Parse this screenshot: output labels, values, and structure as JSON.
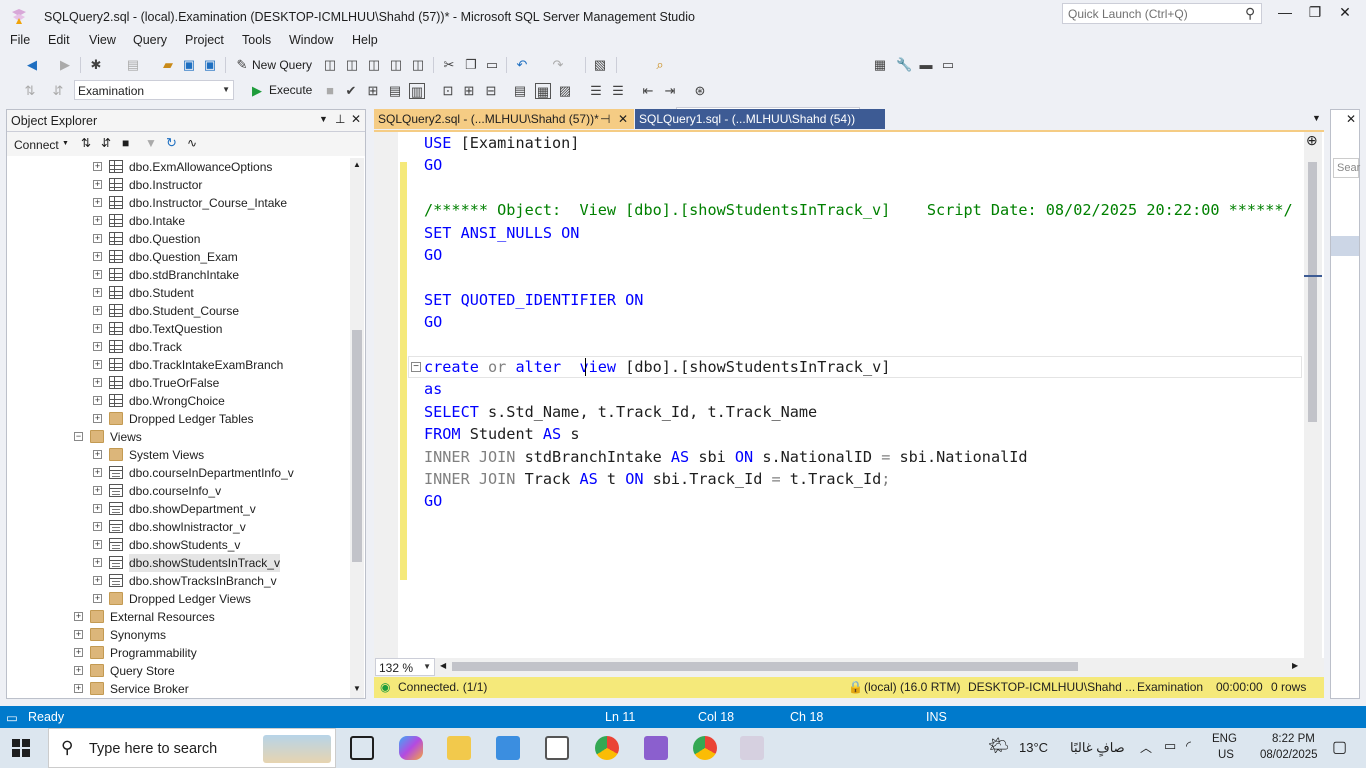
{
  "window": {
    "title": "SQLQuery2.sql - (local).Examination (DESKTOP-ICMLHUU\\Shahd (57))* - Microsoft SQL Server Management Studio",
    "quick_launch_placeholder": "Quick Launch (Ctrl+Q)"
  },
  "menu": [
    "File",
    "Edit",
    "View",
    "Query",
    "Project",
    "Tools",
    "Window",
    "Help"
  ],
  "toolbar": {
    "new_query": "New Query",
    "database": "Examination",
    "execute": "Execute"
  },
  "object_explorer": {
    "title": "Object Explorer",
    "connect": "Connect",
    "nodes": [
      {
        "label": "dbo.ExmAllowanceOptions",
        "type": "table",
        "level": 4
      },
      {
        "label": "dbo.Instructor",
        "type": "table",
        "level": 4
      },
      {
        "label": "dbo.Instructor_Course_Intake",
        "type": "table",
        "level": 4
      },
      {
        "label": "dbo.Intake",
        "type": "table",
        "level": 4
      },
      {
        "label": "dbo.Question",
        "type": "table",
        "level": 4
      },
      {
        "label": "dbo.Question_Exam",
        "type": "table",
        "level": 4
      },
      {
        "label": "dbo.stdBranchIntake",
        "type": "table",
        "level": 4
      },
      {
        "label": "dbo.Student",
        "type": "table",
        "level": 4
      },
      {
        "label": "dbo.Student_Course",
        "type": "table",
        "level": 4
      },
      {
        "label": "dbo.TextQuestion",
        "type": "table",
        "level": 4
      },
      {
        "label": "dbo.Track",
        "type": "table",
        "level": 4
      },
      {
        "label": "dbo.TrackIntakeExamBranch",
        "type": "table",
        "level": 4
      },
      {
        "label": "dbo.TrueOrFalse",
        "type": "table",
        "level": 4
      },
      {
        "label": "dbo.WrongChoice",
        "type": "table",
        "level": 4
      },
      {
        "label": "Dropped Ledger Tables",
        "type": "folder",
        "level": 4
      },
      {
        "label": "Views",
        "type": "folder",
        "level": 3,
        "expanded": true
      },
      {
        "label": "System Views",
        "type": "folder",
        "level": 4
      },
      {
        "label": "dbo.courseInDepartmentInfo_v",
        "type": "view",
        "level": 4
      },
      {
        "label": "dbo.courseInfo_v",
        "type": "view",
        "level": 4
      },
      {
        "label": "dbo.showDepartment_v",
        "type": "view",
        "level": 4
      },
      {
        "label": "dbo.showInistractor_v",
        "type": "view",
        "level": 4
      },
      {
        "label": "dbo.showStudents_v",
        "type": "view",
        "level": 4
      },
      {
        "label": "dbo.showStudentsInTrack_v",
        "type": "view",
        "level": 4,
        "selected": true
      },
      {
        "label": "dbo.showTracksInBranch_v",
        "type": "view",
        "level": 4
      },
      {
        "label": "Dropped Ledger Views",
        "type": "folder",
        "level": 4
      },
      {
        "label": "External Resources",
        "type": "folder",
        "level": 3
      },
      {
        "label": "Synonyms",
        "type": "folder",
        "level": 3
      },
      {
        "label": "Programmability",
        "type": "folder",
        "level": 3
      },
      {
        "label": "Query Store",
        "type": "folder",
        "level": 3
      },
      {
        "label": "Service Broker",
        "type": "folder",
        "level": 3
      }
    ]
  },
  "tabs": [
    {
      "label": "SQLQuery2.sql - (...MLHUU\\Shahd (57))*",
      "active": true
    },
    {
      "label": "SQLQuery1.sql - (...MLHUU\\Shahd (54))",
      "active": false
    }
  ],
  "editor": {
    "zoom": "132 %",
    "lines": [
      [
        {
          "t": "USE [Examination]",
          "c": "kw-mix"
        }
      ],
      [
        {
          "t": "GO",
          "c": "kw"
        }
      ],
      [],
      [
        {
          "t": "/****** Object:  View [dbo].[showStudentsInTrack_v]    Script Date: 08/02/2025 20:22:00 ******/",
          "c": "cm"
        }
      ],
      [
        {
          "t": "SET ANSI_NULLS ON",
          "c": "kw"
        }
      ],
      [
        {
          "t": "GO",
          "c": "kw"
        }
      ],
      [],
      [
        {
          "t": "SET QUOTED_IDENTIFIER ON",
          "c": "kw"
        }
      ],
      [
        {
          "t": "GO",
          "c": "kw"
        }
      ],
      [],
      [
        {
          "t": "create",
          "c": "kw"
        },
        {
          "t": " ",
          "c": ""
        },
        {
          "t": "or",
          "c": "gr"
        },
        {
          "t": " alter  ",
          "c": "kw"
        },
        {
          "t": "view",
          "c": "kw"
        },
        {
          "t": " [dbo].[showStudentsInTrack_v]",
          "c": ""
        }
      ],
      [
        {
          "t": "as",
          "c": "kw"
        }
      ],
      [
        {
          "t": "SELECT",
          "c": "kw"
        },
        {
          "t": " s.Std_Name, t.Track_Id, t.Track_Name",
          "c": ""
        }
      ],
      [
        {
          "t": "FROM",
          "c": "kw"
        },
        {
          "t": " Student ",
          "c": ""
        },
        {
          "t": "AS",
          "c": "kw"
        },
        {
          "t": " s",
          "c": ""
        }
      ],
      [
        {
          "t": "INNER JOIN",
          "c": "gr"
        },
        {
          "t": " stdBranchIntake ",
          "c": ""
        },
        {
          "t": "AS",
          "c": "kw"
        },
        {
          "t": " sbi ",
          "c": ""
        },
        {
          "t": "ON",
          "c": "kw"
        },
        {
          "t": " s.NationalID ",
          "c": ""
        },
        {
          "t": "=",
          "c": "gr"
        },
        {
          "t": " sbi.NationalId",
          "c": ""
        }
      ],
      [
        {
          "t": "INNER JOIN",
          "c": "gr"
        },
        {
          "t": " Track ",
          "c": ""
        },
        {
          "t": "AS",
          "c": "kw"
        },
        {
          "t": " t ",
          "c": ""
        },
        {
          "t": "ON",
          "c": "kw"
        },
        {
          "t": " sbi.Track_Id ",
          "c": ""
        },
        {
          "t": "=",
          "c": "gr"
        },
        {
          "t": " t.Track_Id",
          "c": ""
        },
        {
          "t": ";",
          "c": "gr"
        }
      ],
      [
        {
          "t": "GO",
          "c": "kw"
        }
      ]
    ]
  },
  "query_status": {
    "connected": "Connected. (1/1)",
    "server": "(local) (16.0 RTM)",
    "user": "DESKTOP-ICMLHUU\\Shahd ...",
    "database": "Examination",
    "time": "00:00:00",
    "rows": "0 rows"
  },
  "statusbar": {
    "ready": "Ready",
    "ln": "Ln 11",
    "col": "Col 18",
    "ch": "Ch 18",
    "ins": "INS"
  },
  "taskbar": {
    "search": "Type here to search",
    "weather_temp": "13°C",
    "weather_text": "صافٍ غالبًا",
    "lang_top": "ENG",
    "lang_bottom": "US",
    "time": "8:22 PM",
    "date": "08/02/2025"
  },
  "colors": {
    "accent": "#007acc",
    "tab_active": "#f5cc84",
    "tab_inactive": "#3d5b94",
    "status_yellow": "#f5e97a"
  }
}
